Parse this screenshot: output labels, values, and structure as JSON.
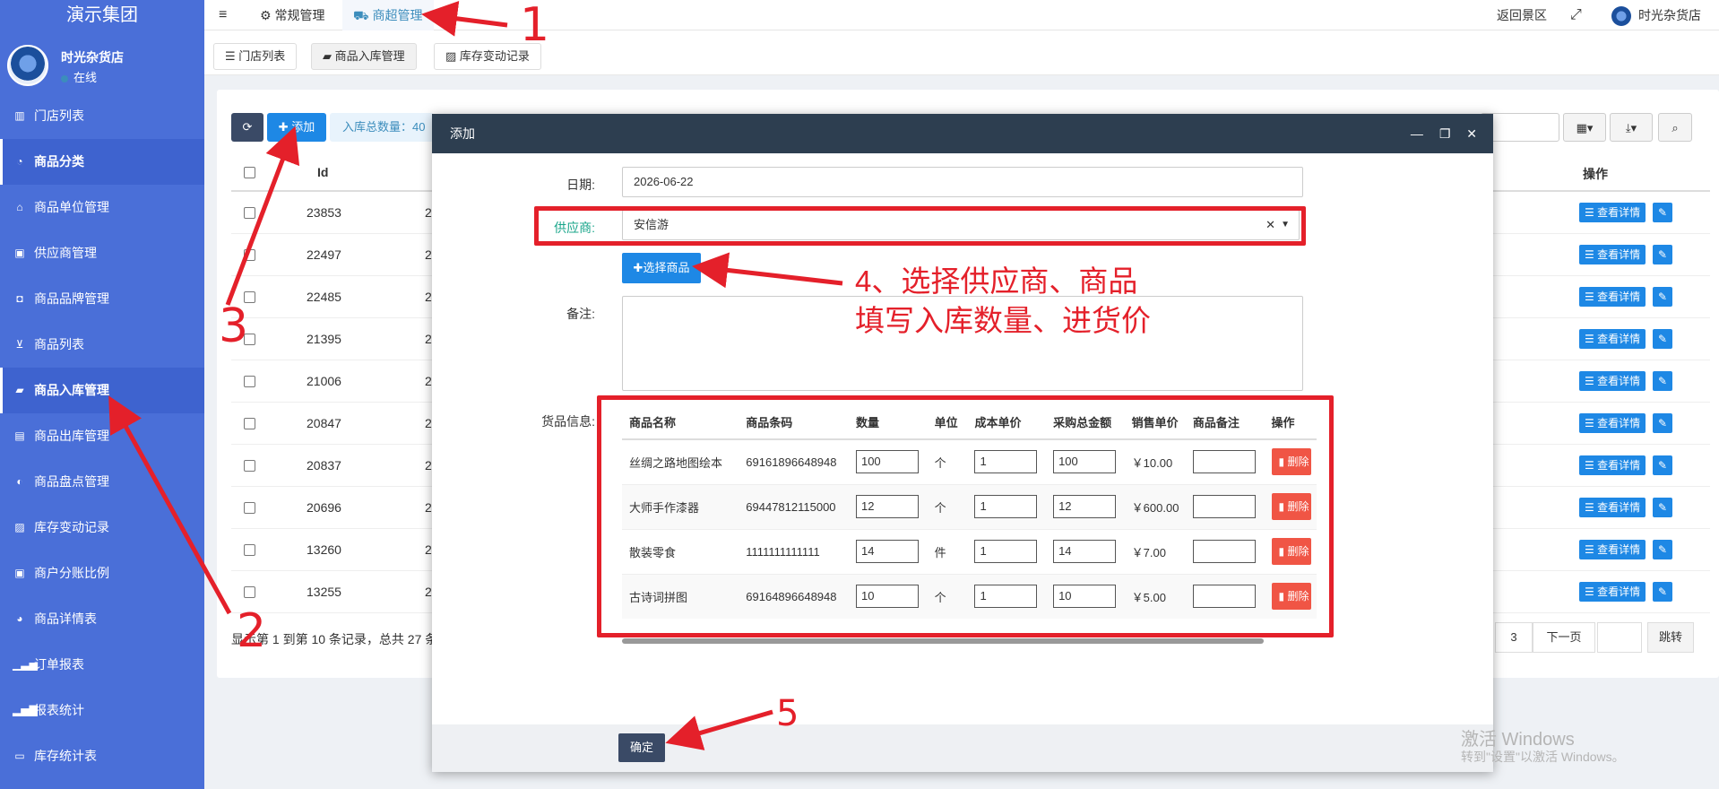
{
  "sidebar": {
    "brand": "演示集团",
    "user_name": "时光杂货店",
    "user_status": "在线",
    "items": [
      {
        "label": "门店列表",
        "icon": "bank-icon"
      },
      {
        "label": "商品分类",
        "icon": "dashboard-icon"
      },
      {
        "label": "商品单位管理",
        "icon": "unit-icon"
      },
      {
        "label": "供应商管理",
        "icon": "contact-icon"
      },
      {
        "label": "商品品牌管理",
        "icon": "brand-icon"
      },
      {
        "label": "商品列表",
        "icon": "cart-icon"
      },
      {
        "label": "商品入库管理",
        "icon": "truck-icon"
      },
      {
        "label": "商品出库管理",
        "icon": "train-icon"
      },
      {
        "label": "商品盘点管理",
        "icon": "circle-half-icon"
      },
      {
        "label": "库存变动记录",
        "icon": "stripes-icon"
      },
      {
        "label": "商户分账比例",
        "icon": "ratio-icon"
      },
      {
        "label": "商品详情表",
        "icon": "globe-icon"
      },
      {
        "label": "订单报表",
        "icon": "bars-icon"
      },
      {
        "label": "报表统计",
        "icon": "chart-icon"
      },
      {
        "label": "库存统计表",
        "icon": "stock-icon"
      }
    ]
  },
  "topbar": {
    "tab_general": "常规管理",
    "tab_supermarket": "商超管理",
    "back_scenic": "返回景区",
    "store_name": "时光杂货店"
  },
  "subtabs": [
    "门店列表",
    "商品入库管理",
    "库存变动记录"
  ],
  "toolbar": {
    "add_label": "添加",
    "total_label": "入库总数量：40"
  },
  "table": {
    "col_id": "Id",
    "col_action": "操作",
    "rows": [
      {
        "id": "23853",
        "c2": "2"
      },
      {
        "id": "22497",
        "c2": "2"
      },
      {
        "id": "22485",
        "c2": "2"
      },
      {
        "id": "21395",
        "c2": "2"
      },
      {
        "id": "21006",
        "c2": "2"
      },
      {
        "id": "20847",
        "c2": "2"
      },
      {
        "id": "20837",
        "c2": "2"
      },
      {
        "id": "20696",
        "c2": "2"
      },
      {
        "id": "13260",
        "c2": "2"
      },
      {
        "id": "13255",
        "c2": "2"
      }
    ],
    "detail_label": "查看详情",
    "footer_text": "显示第 1 到第 10 条记录，总共 27 条",
    "page_3": "3",
    "next_page": "下一页",
    "jump": "跳转"
  },
  "modal": {
    "title": "添加",
    "date_label": "日期:",
    "date_value": "2026-06-22",
    "supplier_label": "供应商:",
    "supplier_value": "安信游",
    "choose_goods": "选择商品",
    "remark_label": "备注:",
    "goods_label": "货品信息:",
    "confirm": "确定",
    "goods_headers": [
      "商品名称",
      "商品条码",
      "数量",
      "单位",
      "成本单价",
      "采购总金额",
      "销售单价",
      "商品备注",
      "操作"
    ],
    "goods": [
      {
        "name": "丝绸之路地图绘本",
        "barcode": "69161896648948",
        "qty": "100",
        "unit": "个",
        "cost": "1",
        "total": "100",
        "price": "￥10.00"
      },
      {
        "name": "大师手作漆器",
        "barcode": "69447812115000",
        "qty": "12",
        "unit": "个",
        "cost": "1",
        "total": "12",
        "price": "￥600.00"
      },
      {
        "name": "散装零食",
        "barcode": "1111111111111",
        "qty": "14",
        "unit": "件",
        "cost": "1",
        "total": "14",
        "price": "￥7.00"
      },
      {
        "name": "古诗词拼图",
        "barcode": "69164896648948",
        "qty": "10",
        "unit": "个",
        "cost": "1",
        "total": "10",
        "price": "￥5.00"
      }
    ],
    "delete_label": "删除"
  },
  "annotations": {
    "n1": "1",
    "n2": "2",
    "n3": "3",
    "n5": "5",
    "step4_line1": "4、选择供应商、商品",
    "step4_line2": "填写入库数量、进货价",
    "color": "#e4202a"
  },
  "watermark": {
    "line1": "激活 Windows",
    "line2": "转到\"设置\"以激活 Windows。"
  }
}
